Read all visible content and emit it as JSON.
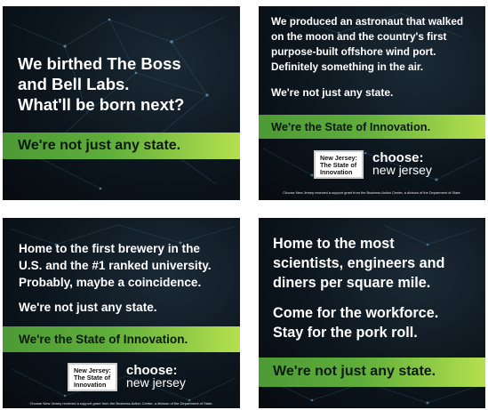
{
  "ads": [
    {
      "headline": [
        "We birthed The Boss",
        "and Bell Labs.",
        "What'll be born next?"
      ],
      "band": "We're not just any state."
    },
    {
      "headline": [
        "We produced an astronaut that walked",
        "on the moon and the country's first",
        "purpose-built offshore wind port.",
        "Definitely something in the air."
      ],
      "subline": "We're not just any state.",
      "band": "We're the State of Innovation.",
      "logo": {
        "box_lines": [
          "New Jersey:",
          "The State of",
          "Innovation"
        ],
        "brand_line1": "choose:",
        "brand_line2": "new jersey"
      },
      "fine_print": "Choose New Jersey received a support grant from the Business Action Center, a division of the Department of State."
    },
    {
      "headline": [
        "Home to the first brewery in the",
        "U.S. and the #1 ranked university.",
        "Probably, maybe a coincidence."
      ],
      "subline": "We're not just any state.",
      "band": "We're the State of Innovation.",
      "logo": {
        "box_lines": [
          "New Jersey:",
          "The State of",
          "Innovation"
        ],
        "brand_line1": "choose:",
        "brand_line2": "new jersey"
      },
      "fine_print": "Choose New Jersey received a support grant from the Business Action Center, a division of the Department of State."
    },
    {
      "headline": [
        "Home to the most",
        "scientists, engineers and",
        "diners per square mile."
      ],
      "subline": [
        "Come for the workforce.",
        "Stay for the pork roll."
      ],
      "band": "We're not just any state."
    }
  ]
}
